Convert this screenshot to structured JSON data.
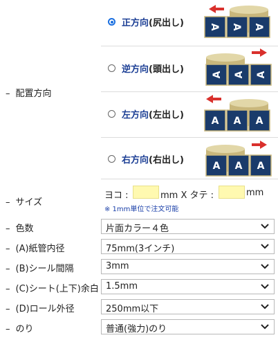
{
  "labels": {
    "orientation": "配置方向",
    "size": "サイズ",
    "color": "色数",
    "core": "(A)紙管内径",
    "gap": "(B)シール間隔",
    "margin": "(C)シート(上下)余白",
    "outer": "(D)ロール外径",
    "glue": "のり"
  },
  "dash": "–",
  "orientation_options": [
    {
      "main": "正方向",
      "paren": "(尻出し)",
      "checked": true,
      "glyph": "A",
      "arrow": "left"
    },
    {
      "main": "逆方向",
      "paren": "(頭出し)",
      "checked": false,
      "glyph": "A",
      "arrow": "right"
    },
    {
      "main": "左方向",
      "paren": "(左出し)",
      "checked": false,
      "glyph": "A",
      "arrow": "left"
    },
    {
      "main": "右方向",
      "paren": "(右出し)",
      "checked": false,
      "glyph": "A",
      "arrow": "right"
    }
  ],
  "size": {
    "yoko_label": "ヨコ :",
    "tate_label": "mm X タテ :",
    "unit": "mm",
    "yoko_value": "",
    "tate_value": "",
    "note": "※ 1mm単位で注文可能"
  },
  "selects": {
    "color": "片面カラー４色",
    "core": "75mm(3インチ)",
    "gap": "3mm",
    "margin": "1.5mm",
    "outer": "250mm以下",
    "glue": "普通(強力)のり"
  },
  "colors": {
    "accent": "#1a6fe0",
    "label_blue": "#1c3f95",
    "roll_gold": "#c9b77c",
    "arrow_red": "#d9302c",
    "input_yellow": "#fff9b0"
  }
}
